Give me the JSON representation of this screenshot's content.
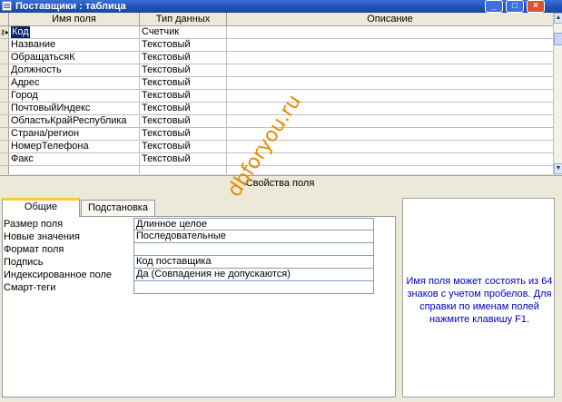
{
  "window": {
    "title": "Поставщики : таблица",
    "buttons": {
      "minimize": "_",
      "maximize": "□",
      "close": "×"
    }
  },
  "grid": {
    "columns": [
      "Имя поля",
      "Тип данных",
      "Описание"
    ],
    "rows": [
      {
        "name": "Код",
        "type": "Счетчик",
        "desc": "",
        "key": true,
        "selected": true
      },
      {
        "name": "Название",
        "type": "Текстовый",
        "desc": ""
      },
      {
        "name": "ОбращатьсяК",
        "type": "Текстовый",
        "desc": ""
      },
      {
        "name": "Должность",
        "type": "Текстовый",
        "desc": ""
      },
      {
        "name": "Адрес",
        "type": "Текстовый",
        "desc": ""
      },
      {
        "name": "Город",
        "type": "Текстовый",
        "desc": ""
      },
      {
        "name": "ПочтовыйИндекс",
        "type": "Текстовый",
        "desc": ""
      },
      {
        "name": "ОбластьКрайРеспублика",
        "type": "Текстовый",
        "desc": ""
      },
      {
        "name": "Страна/регион",
        "type": "Текстовый",
        "desc": ""
      },
      {
        "name": "НомерТелефона",
        "type": "Текстовый",
        "desc": ""
      },
      {
        "name": "Факс",
        "type": "Текстовый",
        "desc": ""
      },
      {
        "name": "",
        "type": "",
        "desc": ""
      }
    ]
  },
  "properties": {
    "section_label": "Свойства поля",
    "tabs": [
      "Общие",
      "Подстановка"
    ],
    "items": [
      {
        "name": "Размер поля",
        "value": "Длинное целое"
      },
      {
        "name": "Новые значения",
        "value": "Последовательные"
      },
      {
        "name": "Формат поля",
        "value": ""
      },
      {
        "name": "Подпись",
        "value": "Код поставщика"
      },
      {
        "name": "Индексированное поле",
        "value": "Да (Совпадения не допускаются)"
      },
      {
        "name": "Смарт-теги",
        "value": ""
      }
    ],
    "help_text": "Имя поля может состоять из 64 знаков с учетом пробелов. Для справки по именам полей нажмите клавишу F1."
  },
  "watermark": "dbforyou.ru",
  "colors": {
    "titlebar": "#1f4fb5",
    "help_text": "#0000c0",
    "watermark": "#e88b00",
    "selection": "#0a246a"
  }
}
